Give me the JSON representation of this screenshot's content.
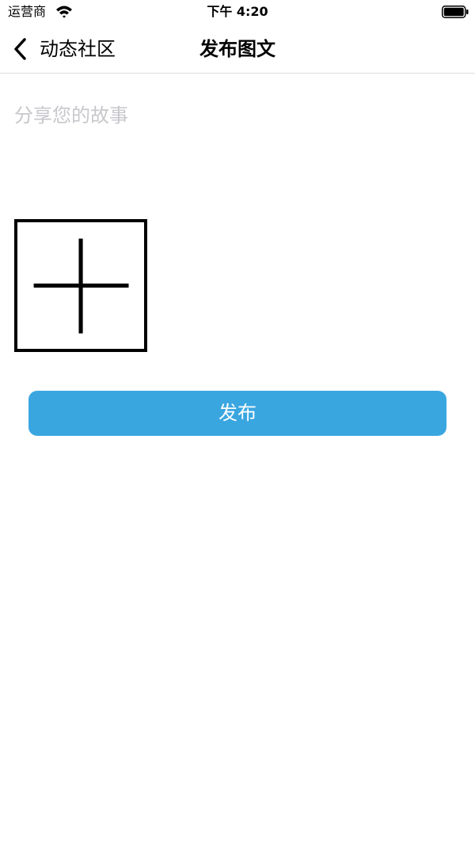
{
  "status_bar": {
    "carrier": "运营商",
    "time": "下午 4:20",
    "icons": [
      "wifi-icon",
      "battery-icon"
    ]
  },
  "nav": {
    "back_label": "动态社区",
    "title": "发布图文",
    "back_icon": "chevron-left-icon"
  },
  "compose": {
    "placeholder": "分享您的故事",
    "value": "",
    "add_image_icon": "plus-icon"
  },
  "actions": {
    "publish_label": "发布"
  },
  "colors": {
    "primary": "#3aa6e0",
    "placeholder": "#c7c7cc",
    "divider": "#dcdcdc",
    "text": "#000000",
    "background": "#ffffff"
  }
}
